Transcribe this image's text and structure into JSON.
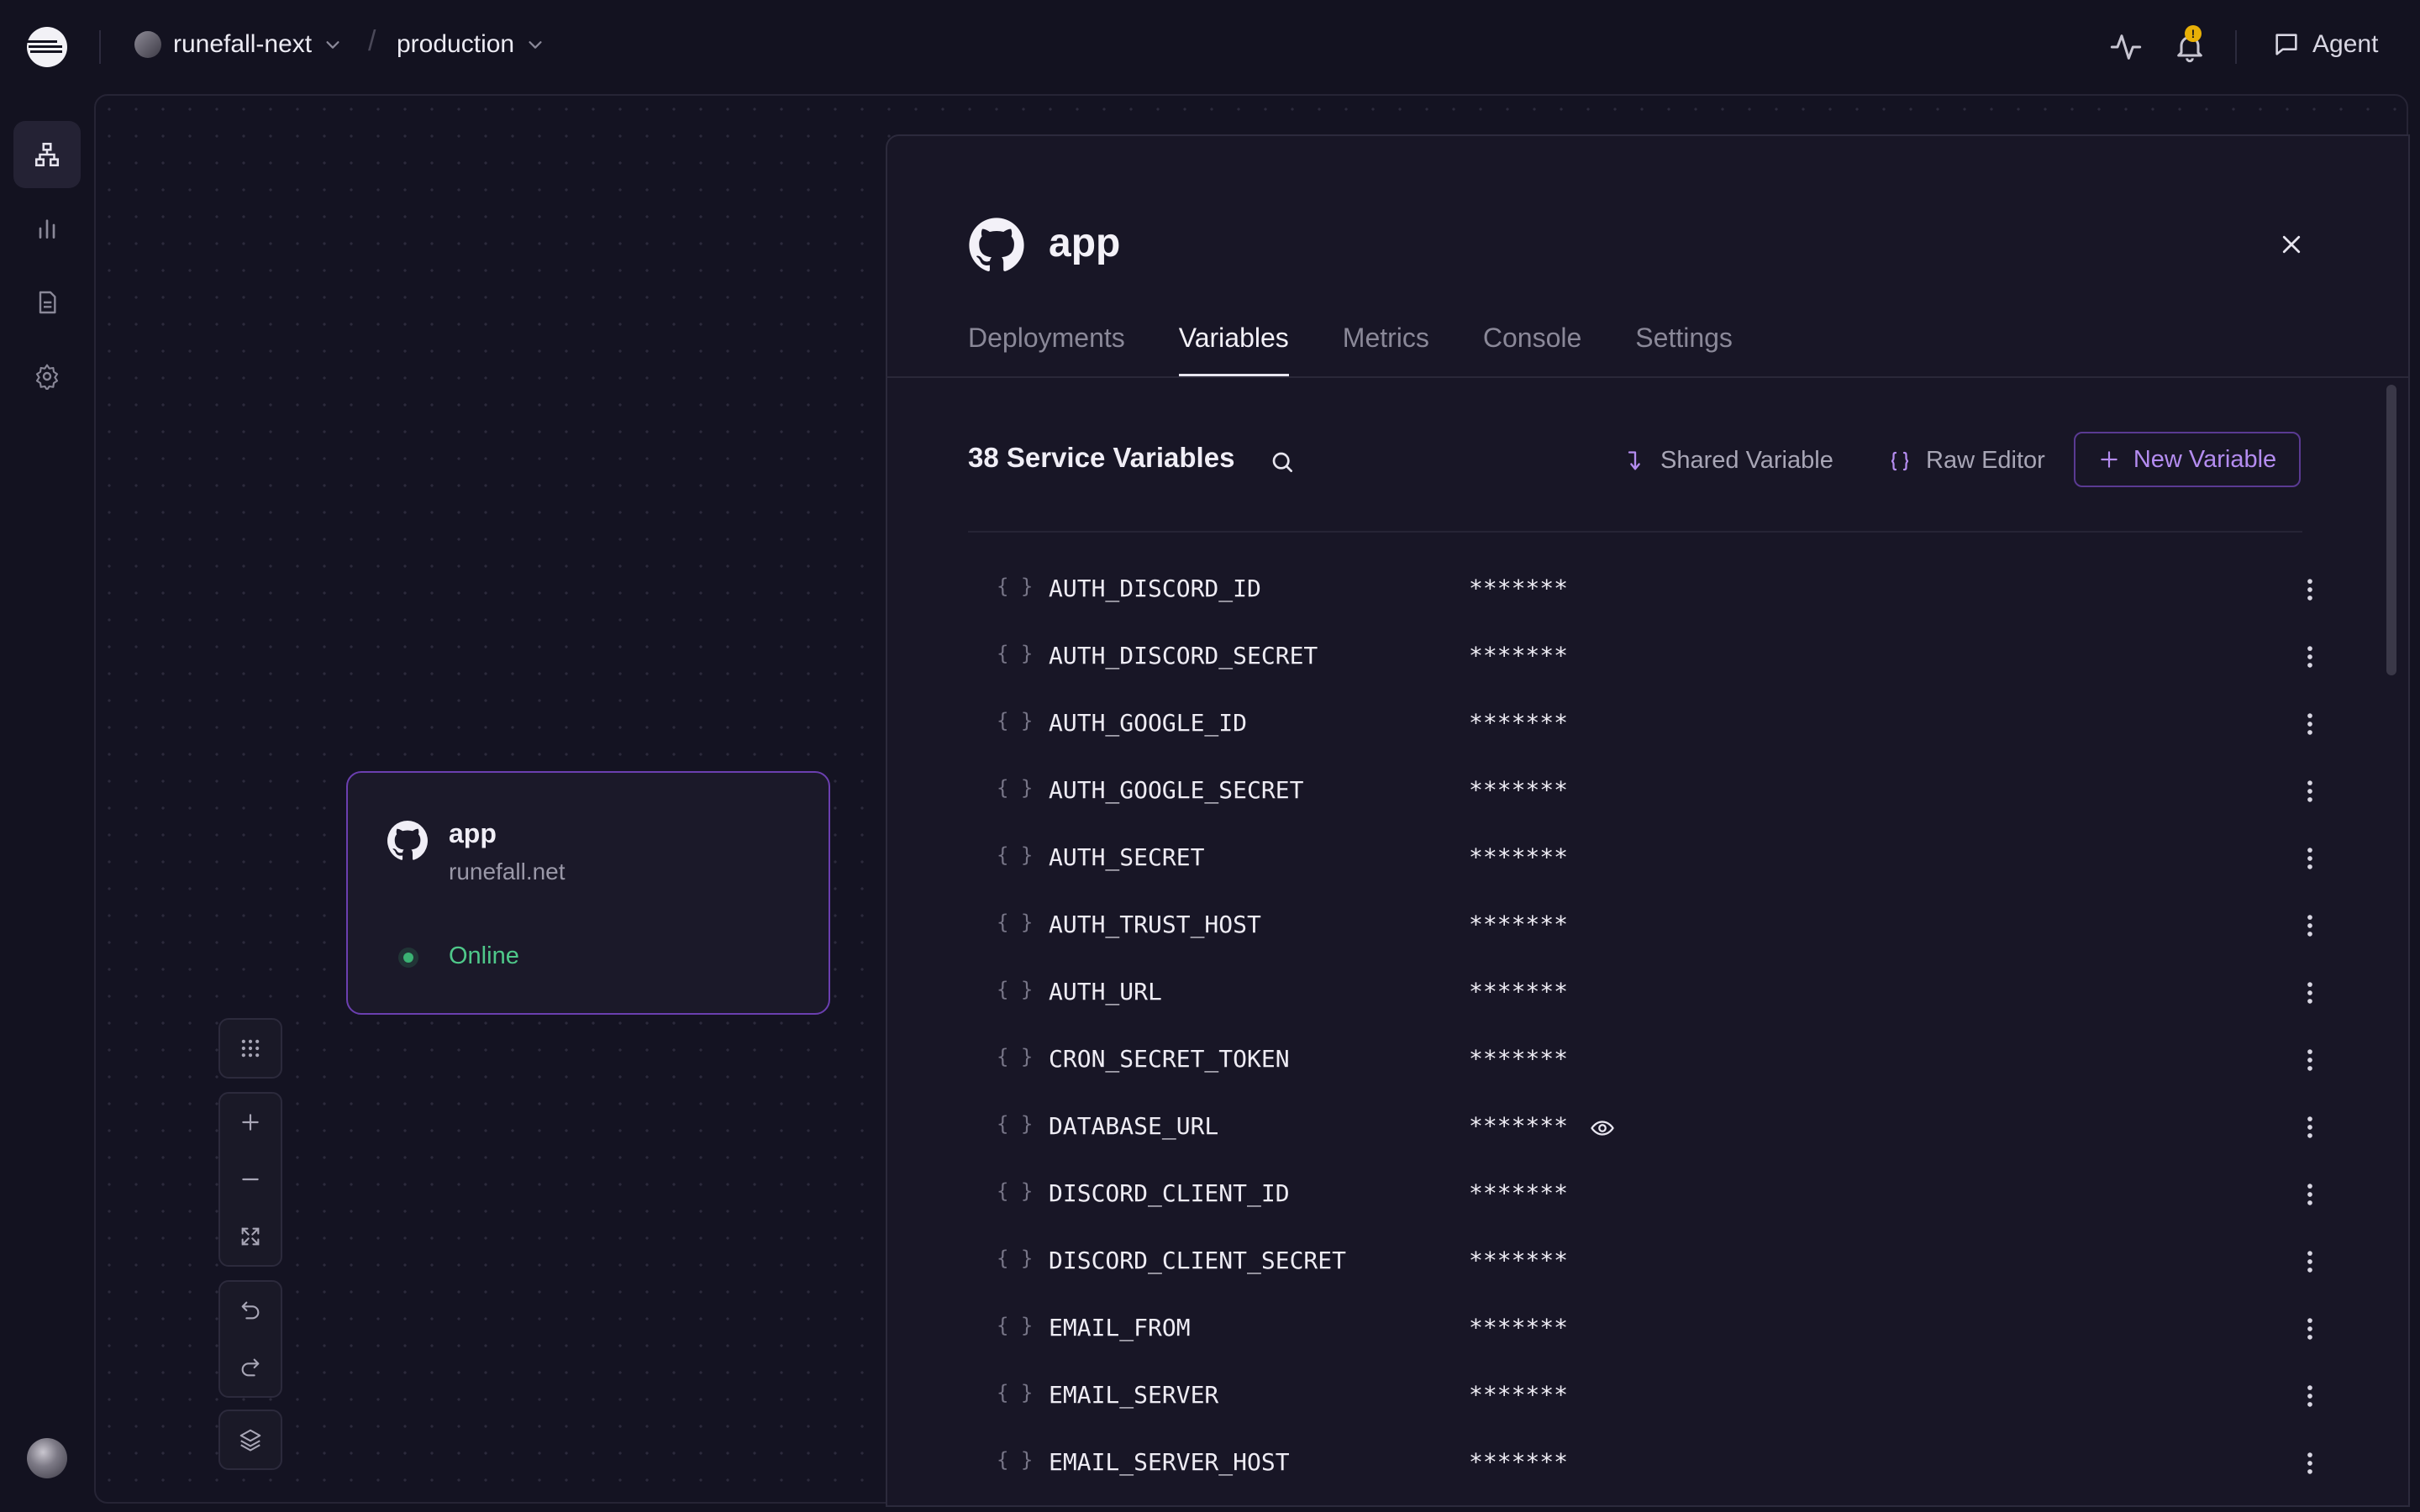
{
  "topbar": {
    "project_name": "runefall-next",
    "environment": "production",
    "separator": "/",
    "notification_badge": "!",
    "agent_label": "Agent"
  },
  "sidebar": {
    "items": [
      {
        "icon": "architecture-icon",
        "active": true
      },
      {
        "icon": "metrics-icon",
        "active": false
      },
      {
        "icon": "logs-icon",
        "active": false
      },
      {
        "icon": "settings-icon",
        "active": false
      }
    ]
  },
  "canvas": {
    "service_card": {
      "name": "app",
      "domain": "runefall.net",
      "status": "Online",
      "status_color": "#3bb273"
    },
    "controls": [
      "grid-icon",
      "zoom-in-icon",
      "zoom-out-icon",
      "fit-view-icon",
      "undo-icon",
      "redo-icon",
      "layers-icon"
    ]
  },
  "panel": {
    "title": "app",
    "tabs": [
      {
        "label": "Deployments",
        "active": false
      },
      {
        "label": "Variables",
        "active": true
      },
      {
        "label": "Metrics",
        "active": false
      },
      {
        "label": "Console",
        "active": false
      },
      {
        "label": "Settings",
        "active": false
      }
    ],
    "variables_heading": "38 Service Variables",
    "shared_variable_label": "Shared Variable",
    "raw_editor_label": "Raw Editor",
    "new_variable_label": "New Variable",
    "accent_color": "#b48cf0",
    "brace_glyph": "{}",
    "variables": [
      {
        "name": "AUTH_DISCORD_ID",
        "value": "*******",
        "reveal": false
      },
      {
        "name": "AUTH_DISCORD_SECRET",
        "value": "*******",
        "reveal": false
      },
      {
        "name": "AUTH_GOOGLE_ID",
        "value": "*******",
        "reveal": false
      },
      {
        "name": "AUTH_GOOGLE_SECRET",
        "value": "*******",
        "reveal": false
      },
      {
        "name": "AUTH_SECRET",
        "value": "*******",
        "reveal": false
      },
      {
        "name": "AUTH_TRUST_HOST",
        "value": "*******",
        "reveal": false
      },
      {
        "name": "AUTH_URL",
        "value": "*******",
        "reveal": false
      },
      {
        "name": "CRON_SECRET_TOKEN",
        "value": "*******",
        "reveal": false
      },
      {
        "name": "DATABASE_URL",
        "value": "*******",
        "reveal": true
      },
      {
        "name": "DISCORD_CLIENT_ID",
        "value": "*******",
        "reveal": false
      },
      {
        "name": "DISCORD_CLIENT_SECRET",
        "value": "*******",
        "reveal": false
      },
      {
        "name": "EMAIL_FROM",
        "value": "*******",
        "reveal": false
      },
      {
        "name": "EMAIL_SERVER",
        "value": "*******",
        "reveal": false
      },
      {
        "name": "EMAIL_SERVER_HOST",
        "value": "*******",
        "reveal": false
      }
    ]
  }
}
